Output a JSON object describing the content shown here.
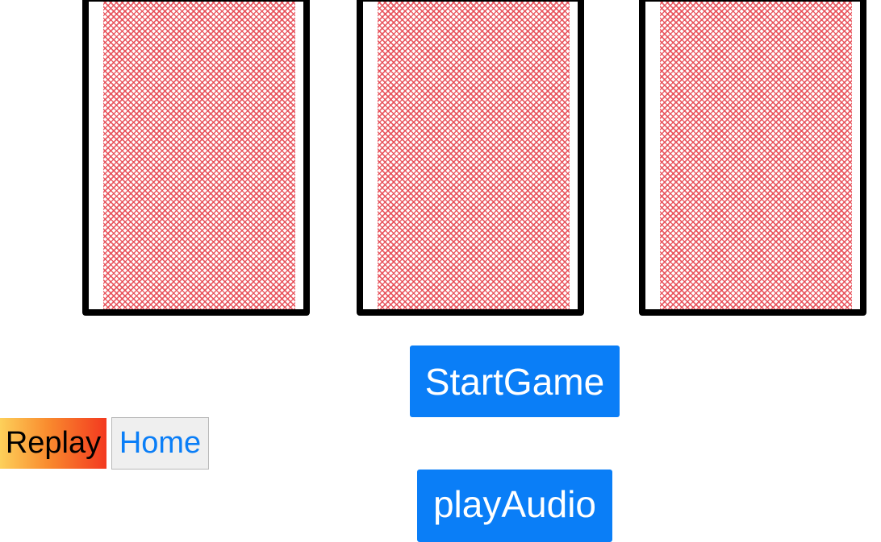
{
  "cards": [
    {
      "face": "back",
      "pattern_color": "#e64650"
    },
    {
      "face": "back",
      "pattern_color": "#e64650"
    },
    {
      "face": "back",
      "pattern_color": "#e64650"
    }
  ],
  "controls": {
    "start_game_label": "StartGame",
    "play_audio_label": "playAudio",
    "replay_label": "Replay",
    "home_label": "Home"
  },
  "colors": {
    "primary_button": "#0a7ef7",
    "card_border": "#000000",
    "card_pattern": "#e64650",
    "replay_gradient": [
      "#fdd05a",
      "#f98b2e",
      "#f3391f"
    ],
    "home_text": "#0a7ef7"
  }
}
